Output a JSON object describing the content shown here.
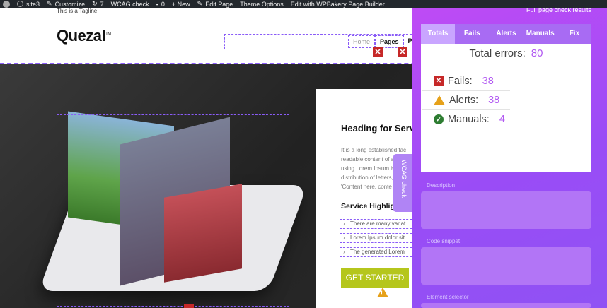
{
  "admin_bar": {
    "site": "site3",
    "customize": "Customize",
    "updates": "7",
    "wcag": "WCAG check",
    "comments": "0",
    "new": "+ New",
    "edit_page": "Edit Page",
    "theme_options": "Theme Options",
    "wpbakery": "Edit with WPBakery Page Builder"
  },
  "site": {
    "tagline": "This is a Tagline",
    "logo": "Quezal",
    "logo_tm": "TM",
    "nav": [
      "Home",
      "Pages",
      "P"
    ]
  },
  "content": {
    "heading": "Heading for Serv",
    "paragraph": "It is a long established fac readable content of a page of using Lorem Ipsum is distribution of letters, as 'Content here, conte",
    "subheading": "Service Highlights –",
    "highlights": [
      "There are many variat",
      "Lorem Ipsum dolor sit",
      "The generated Lorem"
    ],
    "button": "GET STARTED"
  },
  "wcag_tab": "WCAG check",
  "panel": {
    "link": "Full page check results",
    "tabs": [
      "Totals",
      "Fails",
      "Alerts",
      "Manuals",
      "Fix"
    ],
    "active_tab": "Totals",
    "total_label": "Total errors:",
    "total_value": "80",
    "fails_label": "Fails:",
    "fails_value": "38",
    "alerts_label": "Alerts:",
    "alerts_value": "38",
    "manuals_label": "Manuals:",
    "manuals_value": "4",
    "fields": [
      "Description",
      "Code snippet",
      "Element selector"
    ]
  },
  "colors": {
    "accent": "#8a5cf7",
    "panel": "#9a4cf6",
    "fail": "#c62828",
    "alert": "#e6a11a",
    "pass": "#2e7d32",
    "button": "#b5c61c"
  }
}
